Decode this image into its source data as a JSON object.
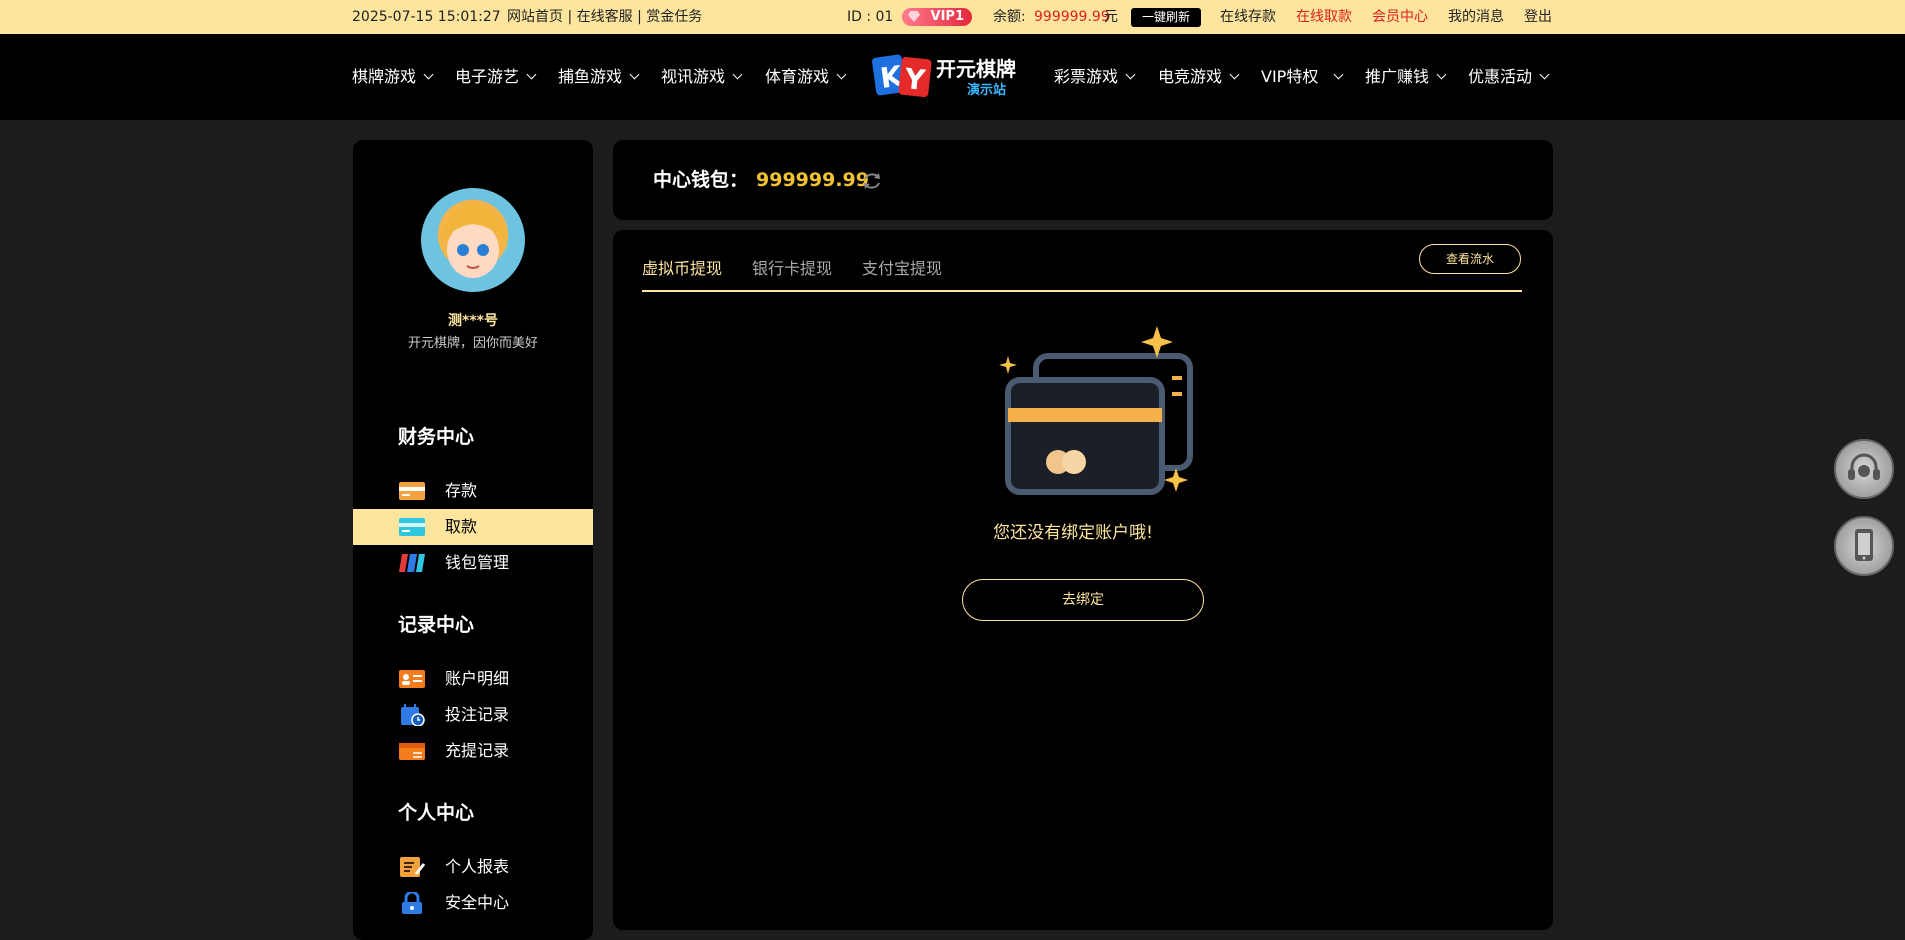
{
  "topbar": {
    "datetime": "2025-07-15 15:01:27",
    "links": "网站首页 | 在线客服 | 赏金任务",
    "id_label": "ID : 01",
    "vip_label": "VIP1",
    "balance_label": "余额:",
    "balance_value": "999999.99",
    "balance_unit": "元",
    "refresh_label": "一键刷新",
    "deposit_link": "在线存款",
    "withdraw_link": "在线取款",
    "member_link": "会员中心",
    "messages_link": "我的消息",
    "logout_link": "登出"
  },
  "nav": {
    "items": [
      "棋牌游戏",
      "电子游艺",
      "捕鱼游戏",
      "视讯游戏",
      "体育游戏",
      "彩票游戏",
      "电竞游戏",
      "VIP特权",
      "推广赚钱",
      "优惠活动"
    ],
    "logo_text": "开元棋牌",
    "logo_sub": "演示站"
  },
  "sidebar": {
    "username": "测***号",
    "motto": "开元棋牌，因你而美好",
    "sections": [
      {
        "title": "财务中心",
        "items": [
          "存款",
          "取款",
          "钱包管理"
        ]
      },
      {
        "title": "记录中心",
        "items": [
          "账户明细",
          "投注记录",
          "充提记录"
        ]
      },
      {
        "title": "个人中心",
        "items": [
          "个人报表",
          "安全中心"
        ]
      }
    ],
    "active_item": "取款"
  },
  "wallet": {
    "label": "中心钱包：",
    "amount": "999999.99"
  },
  "main": {
    "tabs": [
      "虚拟币提现",
      "银行卡提现",
      "支付宝提现"
    ],
    "flow_button": "查看流水",
    "empty_message": "您还没有绑定账户哦!",
    "bind_button": "去绑定"
  },
  "colors": {
    "accent_gold": "#fde59e",
    "amount_yellow": "#f2c230",
    "alert_red": "#e02020"
  }
}
